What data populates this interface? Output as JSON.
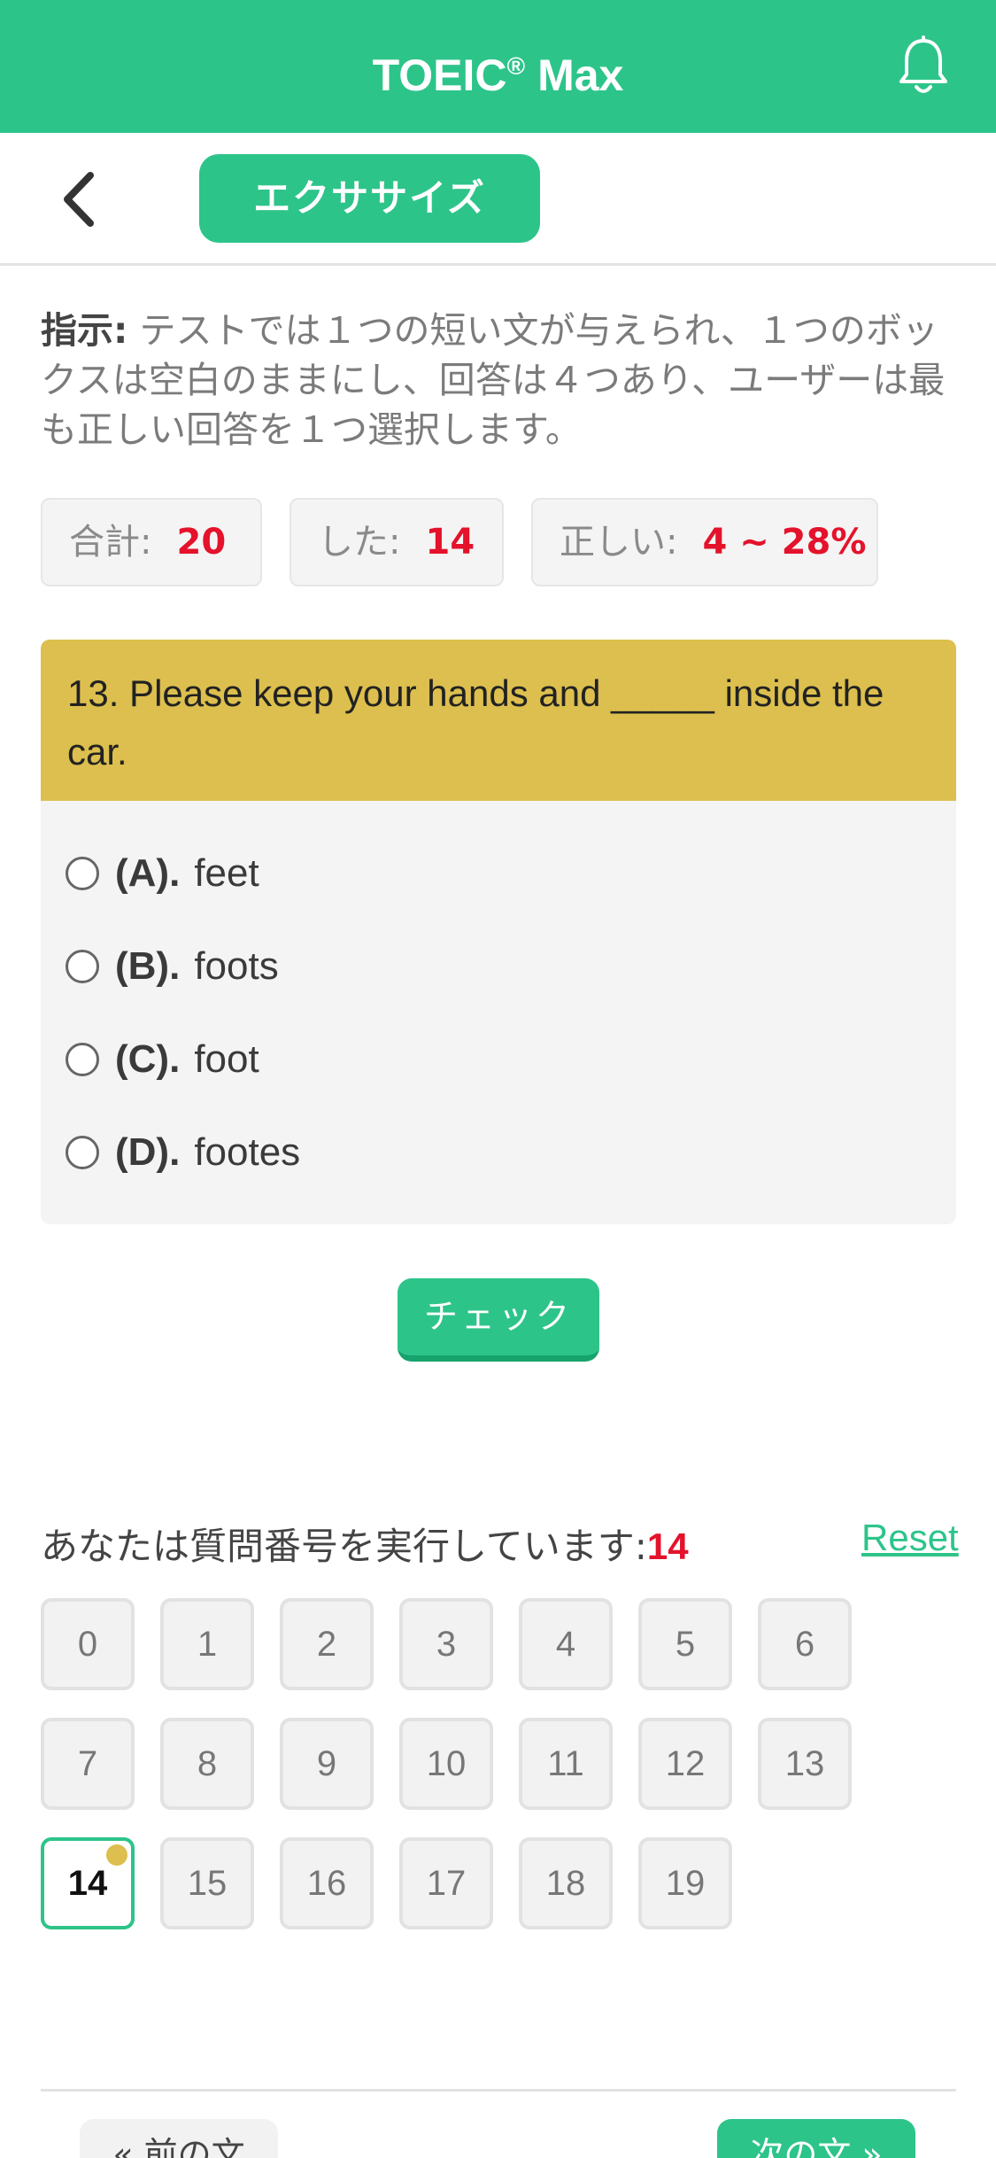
{
  "header": {
    "title_main": "TOEIC",
    "title_reg": "®",
    "title_suffix": " Max",
    "bell_icon": "bell-icon"
  },
  "nav": {
    "back_icon": "chevron-left-icon",
    "tab_label": "エクササイズ"
  },
  "instruction": {
    "label": "指示:",
    "text": " テストでは１つの短い文が与えられ、１つのボックスは空白のままにし、回答は４つあり、ユーザーは最も正しい回答を１つ選択します。"
  },
  "stats": {
    "total_label": "合計:",
    "total_value": "20",
    "done_label": "した:",
    "done_value": "14",
    "correct_label": "正しい:",
    "correct_value": "4 ~ 28%"
  },
  "question": {
    "text": "13. Please keep your hands and _____ inside the car.",
    "options": [
      {
        "label": "(A).",
        "text": "feet"
      },
      {
        "label": "(B).",
        "text": "foots"
      },
      {
        "label": "(C).",
        "text": "foot"
      },
      {
        "label": "(D).",
        "text": "footes"
      }
    ]
  },
  "check_label": "チェック",
  "progress": {
    "text": "あなたは質問番号を実行しています:",
    "current": "14",
    "reset_label": "Reset"
  },
  "question_numbers": [
    "0",
    "1",
    "2",
    "3",
    "4",
    "5",
    "6",
    "7",
    "8",
    "9",
    "10",
    "11",
    "12",
    "13",
    "14",
    "15",
    "16",
    "17",
    "18",
    "19"
  ],
  "active_question": 14,
  "footer": {
    "prev_label": "« 前の文",
    "next_label": "次の文 »"
  },
  "colors": {
    "brand_green": "#2dc48a",
    "question_header": "#dcbf4e",
    "highlight_red": "#e4122b"
  }
}
